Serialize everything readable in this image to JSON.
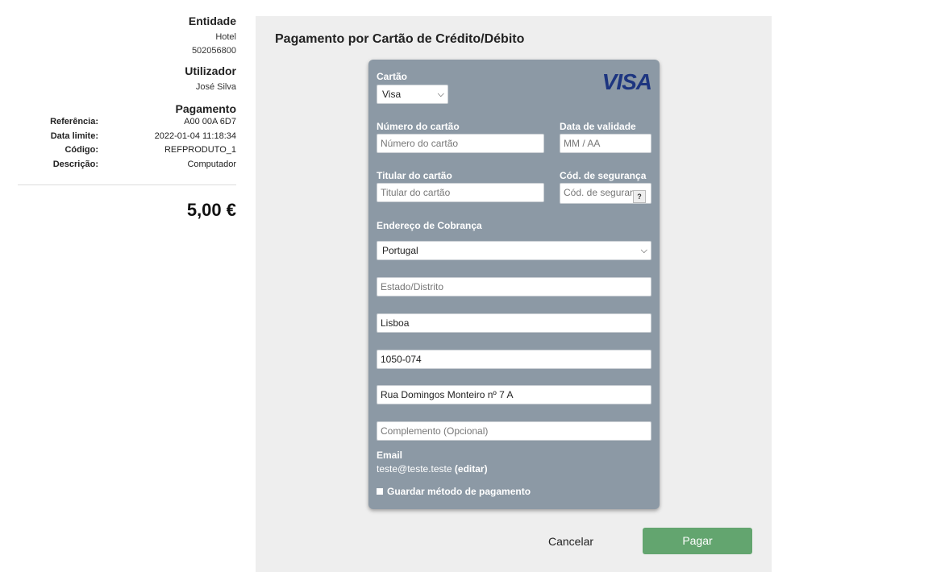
{
  "sidebar": {
    "entity_heading": "Entidade",
    "entity_name": "Hotel",
    "entity_id": "502056800",
    "user_heading": "Utilizador",
    "user_name": "José Silva",
    "payment_heading": "Pagamento",
    "details": [
      {
        "key": "Referência:",
        "value": "A00 00A 6D7"
      },
      {
        "key": "Data limite:",
        "value": "2022-01-04 11:18:34"
      },
      {
        "key": "Código:",
        "value": "REFPRODUTO_1"
      },
      {
        "key": "Descrição:",
        "value": "Computador"
      }
    ],
    "total": "5,00 €"
  },
  "main": {
    "title": "Pagamento por Cartão de Crédito/Débito",
    "card": {
      "brand_logo": "VISA",
      "card_label": "Cartão",
      "card_select_value": "Visa",
      "number_label": "Número do cartão",
      "number_placeholder": "Número do cartão",
      "expiry_label": "Data de validade",
      "expiry_placeholder": "MM / AA",
      "holder_label": "Titular do cartão",
      "holder_placeholder": "Titular do cartão",
      "cvv_label": "Cód. de segurança",
      "cvv_placeholder": "Cód. de segurança",
      "cvv_help": "?",
      "billing_label": "Endereço de Cobrança",
      "country_value": "Portugal",
      "state_placeholder": "Estado/Distrito",
      "city_value": "Lisboa",
      "postal_value": "1050-074",
      "street_value": "Rua Domingos Monteiro nº 7 A",
      "complement_placeholder": "Complemento (Opcional)",
      "email_label": "Email",
      "email_value": "teste@teste.teste",
      "email_edit": "(editar)",
      "save_label": "Guardar método de pagamento"
    },
    "cancel_label": "Cancelar",
    "pay_label": "Pagar"
  },
  "colors": {
    "card_bg": "#8c99a5",
    "panel_bg": "#eeeeee",
    "pay_button": "#63a56f",
    "visa_blue": "#1d3580"
  }
}
